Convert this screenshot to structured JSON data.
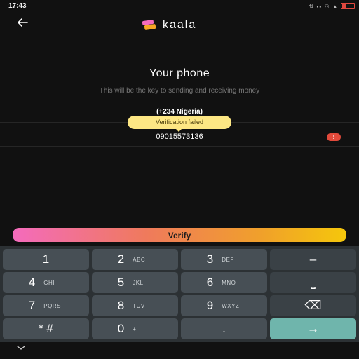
{
  "status": {
    "time": "17:43",
    "icons_text": "⇅ ▪▪ ⚇ ▲"
  },
  "header": {
    "brand": "kaala",
    "back_icon": "arrow-left-icon"
  },
  "page": {
    "title": "Your phone",
    "subtitle": "This will be the key to sending and receiving money",
    "country": "(+234 Nigeria)",
    "tooltip": "Verification failed",
    "phone_value": "09015573136",
    "error_badge": "!"
  },
  "verify_label": "Verify",
  "keyboard": {
    "keys": [
      {
        "digit": "1",
        "letters": ""
      },
      {
        "digit": "2",
        "letters": "ABC"
      },
      {
        "digit": "3",
        "letters": "DEF"
      },
      {
        "digit": "–",
        "letters": ""
      },
      {
        "digit": "4",
        "letters": "GHI"
      },
      {
        "digit": "5",
        "letters": "JKL"
      },
      {
        "digit": "6",
        "letters": "MNO"
      },
      {
        "digit": "⎵",
        "letters": ""
      },
      {
        "digit": "7",
        "letters": "PQRS"
      },
      {
        "digit": "8",
        "letters": "TUV"
      },
      {
        "digit": "9",
        "letters": "WXYZ"
      },
      {
        "digit": "⌫",
        "letters": ""
      },
      {
        "digit": "* #",
        "letters": ""
      },
      {
        "digit": "0",
        "letters": "+"
      },
      {
        "digit": ".",
        "letters": ""
      },
      {
        "digit": "→",
        "letters": ""
      }
    ]
  },
  "colors": {
    "background": "#111111",
    "tooltip": "#fde784",
    "error": "#e24a3b",
    "verify_gradient": [
      "#f46bbd",
      "#ef7a5c",
      "#f0a12a",
      "#f5c70b"
    ],
    "key": "#474f55",
    "enter_key": "#6fb5ac"
  }
}
